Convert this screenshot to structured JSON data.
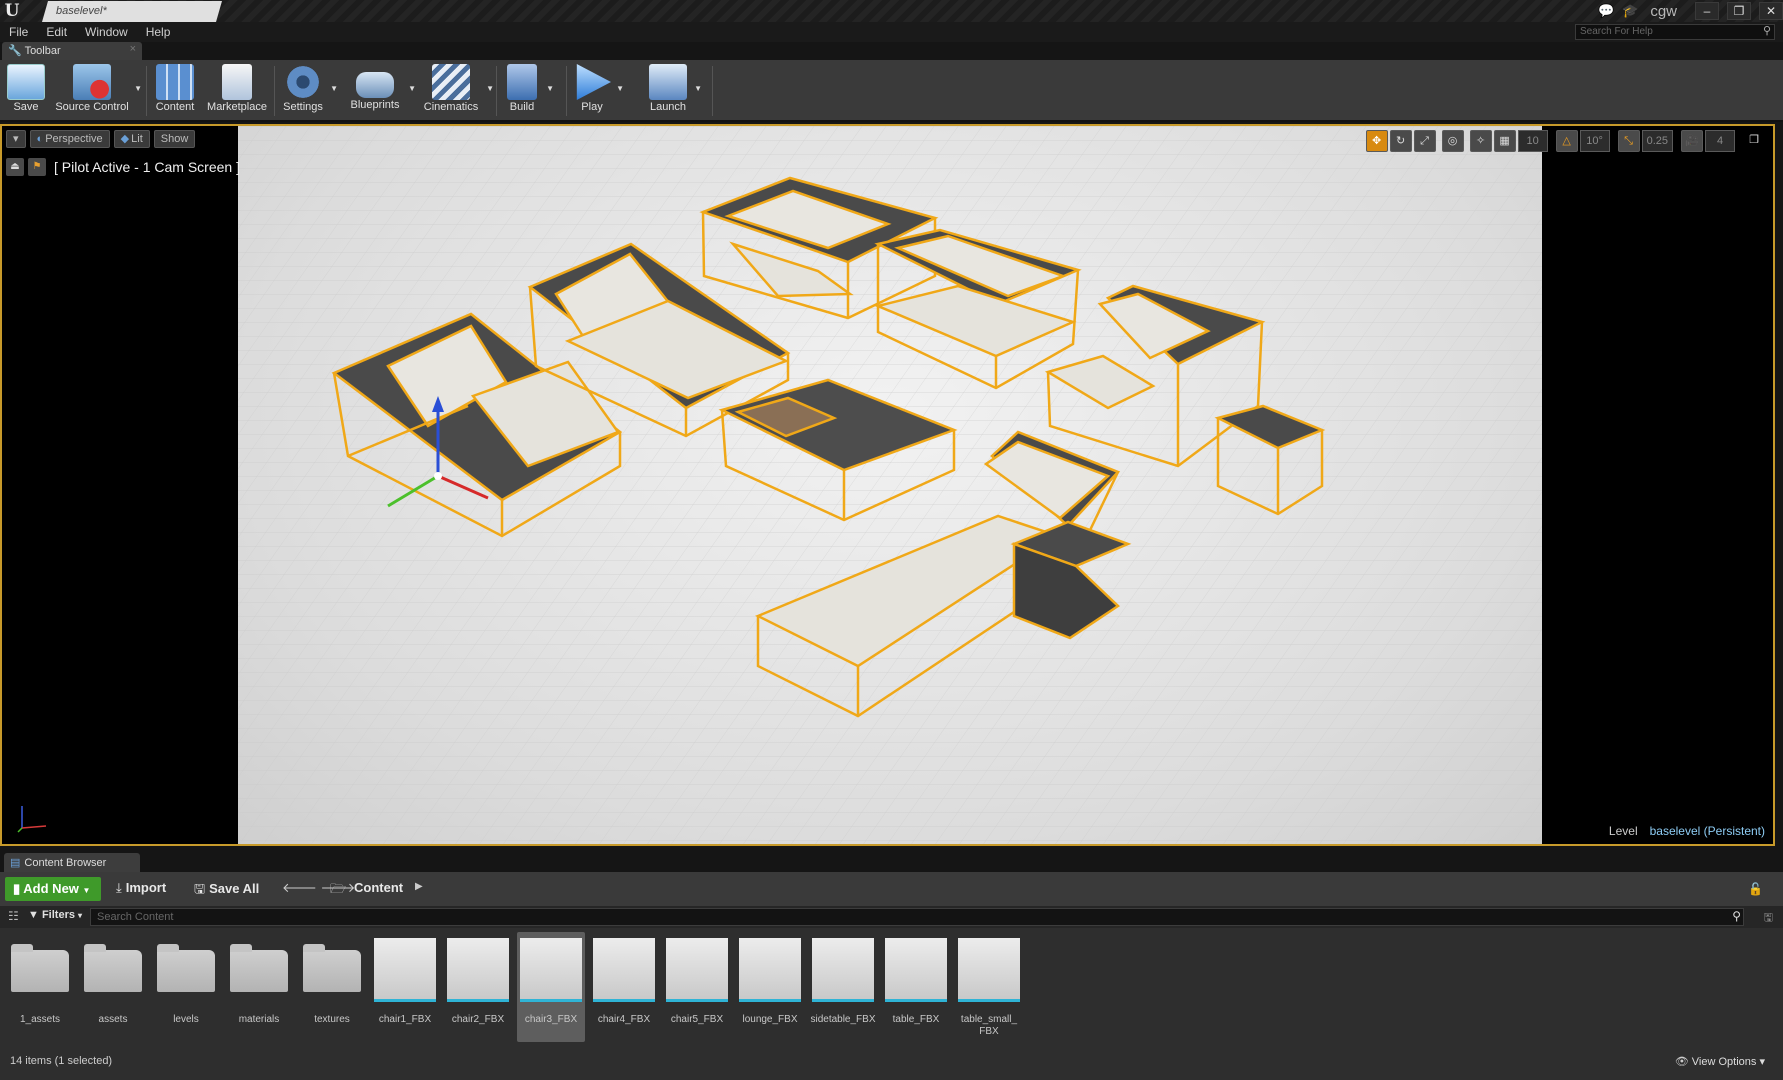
{
  "titlebar": {
    "tab_title": "baselevel*",
    "user": "cgw",
    "minimize": "–",
    "restore": "❐",
    "close": "✕"
  },
  "menu": {
    "items": [
      "File",
      "Edit",
      "Window",
      "Help"
    ],
    "help_search_placeholder": "Search For Help"
  },
  "toolbar": {
    "tab_label": "Toolbar",
    "tools": [
      {
        "label": "Save"
      },
      {
        "label": "Source Control"
      },
      {
        "label": "Content"
      },
      {
        "label": "Marketplace"
      },
      {
        "label": "Settings"
      },
      {
        "label": "Blueprints"
      },
      {
        "label": "Cinematics"
      },
      {
        "label": "Build"
      },
      {
        "label": "Play"
      },
      {
        "label": "Launch"
      }
    ]
  },
  "viewport": {
    "view_menu": "▾",
    "perspective": "Perspective",
    "lit": "Lit",
    "show": "Show",
    "pilot_text": "[ Pilot Active - 1 Cam Screen ]",
    "grid_snap": "10",
    "rot_snap": "10°",
    "scale_snap": "0.25",
    "cam_speed": "4",
    "level_prefix": "Level",
    "level_name": "baselevel (Persistent)"
  },
  "content_browser": {
    "tab_label": "Content Browser",
    "add_new": "Add New",
    "import": "Import",
    "save_all": "Save All",
    "path": "Content",
    "filters": "Filters",
    "search_placeholder": "Search Content",
    "assets": [
      {
        "name": "1_assets",
        "kind": "folder"
      },
      {
        "name": "assets",
        "kind": "folder"
      },
      {
        "name": "levels",
        "kind": "folder"
      },
      {
        "name": "materials",
        "kind": "folder"
      },
      {
        "name": "textures",
        "kind": "folder"
      },
      {
        "name": "chair1_FBX",
        "kind": "mesh"
      },
      {
        "name": "chair2_FBX",
        "kind": "mesh"
      },
      {
        "name": "chair3_FBX",
        "kind": "mesh",
        "selected": true
      },
      {
        "name": "chair4_FBX",
        "kind": "mesh"
      },
      {
        "name": "chair5_FBX",
        "kind": "mesh"
      },
      {
        "name": "lounge_FBX",
        "kind": "mesh"
      },
      {
        "name": "sidetable_FBX",
        "kind": "mesh"
      },
      {
        "name": "table_FBX",
        "kind": "mesh"
      },
      {
        "name": "table_small_\nFBX",
        "kind": "mesh"
      }
    ],
    "item_count": "14 items (1 selected)",
    "view_options": "View Options"
  },
  "colors": {
    "selection_outline": "#f0a818",
    "add_new_green": "#3f9a2a",
    "level_text": "#8ecdf5"
  }
}
